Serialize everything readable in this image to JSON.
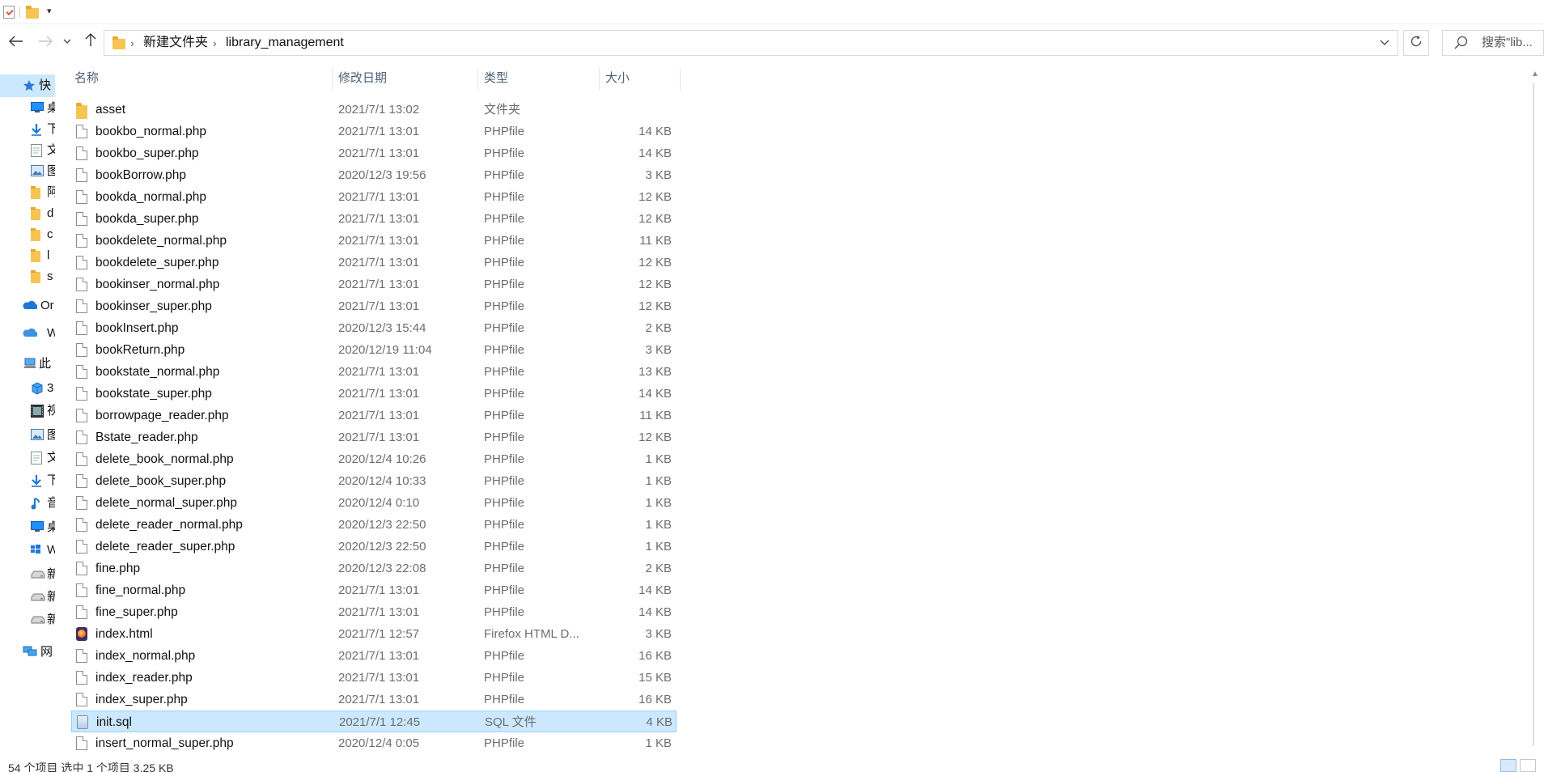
{
  "window": {
    "quick_access_dropdown": "▾"
  },
  "navigation": {
    "back_icon": "arrow-left-icon",
    "forward_icon": "arrow-right-icon",
    "recent_icon": "chevron-down-icon",
    "up_icon": "arrow-up-icon",
    "breadcrumb": [
      "新建文件夹",
      "library_management"
    ],
    "refresh_icon": "refresh-icon",
    "search_placeholder": "搜索\"lib..."
  },
  "nav_pane": [
    {
      "label": "快",
      "icon": "star-icon",
      "selected": true
    },
    {
      "label": "桌",
      "icon": "desktop-icon"
    },
    {
      "label": "下",
      "icon": "download-icon"
    },
    {
      "label": "文",
      "icon": "document-icon"
    },
    {
      "label": "图",
      "icon": "picture-icon"
    },
    {
      "label": "阿",
      "icon": "folder-icon"
    },
    {
      "label": "d",
      "icon": "folder-icon"
    },
    {
      "label": "c",
      "icon": "folder-icon"
    },
    {
      "label": "l",
      "icon": "folder-icon"
    },
    {
      "label": "s",
      "icon": "folder-icon"
    },
    {
      "label": "Or",
      "icon": "onedrive-icon"
    },
    {
      "label": "W",
      "icon": "cloud-icon"
    },
    {
      "label": "此",
      "icon": "computer-icon"
    },
    {
      "label": "3",
      "icon": "cube-icon"
    },
    {
      "label": "视",
      "icon": "video-icon"
    },
    {
      "label": "图",
      "icon": "picture-icon"
    },
    {
      "label": "文",
      "icon": "document-icon"
    },
    {
      "label": "下",
      "icon": "download-icon"
    },
    {
      "label": "音",
      "icon": "music-icon"
    },
    {
      "label": "桌",
      "icon": "desktop-icon"
    },
    {
      "label": "W",
      "icon": "windows-icon"
    },
    {
      "label": "新",
      "icon": "drive-icon"
    },
    {
      "label": "新",
      "icon": "drive-icon"
    },
    {
      "label": "新",
      "icon": "drive-icon"
    },
    {
      "label": "网",
      "icon": "network-icon"
    }
  ],
  "columns": {
    "name": "名称",
    "date": "修改日期",
    "type": "类型",
    "size": "大小",
    "sort_indicator": "^"
  },
  "files": [
    {
      "name": "asset",
      "date": "2021/7/1 13:02",
      "type": "文件夹",
      "size": "",
      "icon": "folder-icon"
    },
    {
      "name": "bookbo_normal.php",
      "date": "2021/7/1 13:01",
      "type": "PHPfile",
      "size": "14 KB",
      "icon": "file-icon"
    },
    {
      "name": "bookbo_super.php",
      "date": "2021/7/1 13:01",
      "type": "PHPfile",
      "size": "14 KB",
      "icon": "file-icon"
    },
    {
      "name": "bookBorrow.php",
      "date": "2020/12/3 19:56",
      "type": "PHPfile",
      "size": "3 KB",
      "icon": "file-icon"
    },
    {
      "name": "bookda_normal.php",
      "date": "2021/7/1 13:01",
      "type": "PHPfile",
      "size": "12 KB",
      "icon": "file-icon"
    },
    {
      "name": "bookda_super.php",
      "date": "2021/7/1 13:01",
      "type": "PHPfile",
      "size": "12 KB",
      "icon": "file-icon"
    },
    {
      "name": "bookdelete_normal.php",
      "date": "2021/7/1 13:01",
      "type": "PHPfile",
      "size": "11 KB",
      "icon": "file-icon"
    },
    {
      "name": "bookdelete_super.php",
      "date": "2021/7/1 13:01",
      "type": "PHPfile",
      "size": "12 KB",
      "icon": "file-icon"
    },
    {
      "name": "bookinser_normal.php",
      "date": "2021/7/1 13:01",
      "type": "PHPfile",
      "size": "12 KB",
      "icon": "file-icon"
    },
    {
      "name": "bookinser_super.php",
      "date": "2021/7/1 13:01",
      "type": "PHPfile",
      "size": "12 KB",
      "icon": "file-icon"
    },
    {
      "name": "bookInsert.php",
      "date": "2020/12/3 15:44",
      "type": "PHPfile",
      "size": "2 KB",
      "icon": "file-icon"
    },
    {
      "name": "bookReturn.php",
      "date": "2020/12/19 11:04",
      "type": "PHPfile",
      "size": "3 KB",
      "icon": "file-icon"
    },
    {
      "name": "bookstate_normal.php",
      "date": "2021/7/1 13:01",
      "type": "PHPfile",
      "size": "13 KB",
      "icon": "file-icon"
    },
    {
      "name": "bookstate_super.php",
      "date": "2021/7/1 13:01",
      "type": "PHPfile",
      "size": "14 KB",
      "icon": "file-icon"
    },
    {
      "name": "borrowpage_reader.php",
      "date": "2021/7/1 13:01",
      "type": "PHPfile",
      "size": "11 KB",
      "icon": "file-icon"
    },
    {
      "name": "Bstate_reader.php",
      "date": "2021/7/1 13:01",
      "type": "PHPfile",
      "size": "12 KB",
      "icon": "file-icon"
    },
    {
      "name": "delete_book_normal.php",
      "date": "2020/12/4 10:26",
      "type": "PHPfile",
      "size": "1 KB",
      "icon": "file-icon"
    },
    {
      "name": "delete_book_super.php",
      "date": "2020/12/4 10:33",
      "type": "PHPfile",
      "size": "1 KB",
      "icon": "file-icon"
    },
    {
      "name": "delete_normal_super.php",
      "date": "2020/12/4 0:10",
      "type": "PHPfile",
      "size": "1 KB",
      "icon": "file-icon"
    },
    {
      "name": "delete_reader_normal.php",
      "date": "2020/12/3 22:50",
      "type": "PHPfile",
      "size": "1 KB",
      "icon": "file-icon"
    },
    {
      "name": "delete_reader_super.php",
      "date": "2020/12/3 22:50",
      "type": "PHPfile",
      "size": "1 KB",
      "icon": "file-icon"
    },
    {
      "name": "fine.php",
      "date": "2020/12/3 22:08",
      "type": "PHPfile",
      "size": "2 KB",
      "icon": "file-icon"
    },
    {
      "name": "fine_normal.php",
      "date": "2021/7/1 13:01",
      "type": "PHPfile",
      "size": "14 KB",
      "icon": "file-icon"
    },
    {
      "name": "fine_super.php",
      "date": "2021/7/1 13:01",
      "type": "PHPfile",
      "size": "14 KB",
      "icon": "file-icon"
    },
    {
      "name": "index.html",
      "date": "2021/7/1 12:57",
      "type": "Firefox HTML D...",
      "size": "3 KB",
      "icon": "firefox-icon"
    },
    {
      "name": "index_normal.php",
      "date": "2021/7/1 13:01",
      "type": "PHPfile",
      "size": "16 KB",
      "icon": "file-icon"
    },
    {
      "name": "index_reader.php",
      "date": "2021/7/1 13:01",
      "type": "PHPfile",
      "size": "15 KB",
      "icon": "file-icon"
    },
    {
      "name": "index_super.php",
      "date": "2021/7/1 13:01",
      "type": "PHPfile",
      "size": "16 KB",
      "icon": "file-icon"
    },
    {
      "name": "init.sql",
      "date": "2021/7/1 12:45",
      "type": "SQL 文件",
      "size": "4 KB",
      "icon": "sql-icon",
      "selected": true
    },
    {
      "name": "insert_normal_super.php",
      "date": "2020/12/4 0:05",
      "type": "PHPfile",
      "size": "1 KB",
      "icon": "file-icon"
    }
  ],
  "status": {
    "text": "54 个项目    选中 1 个项目  3.25 KB"
  },
  "colors": {
    "selection_bg": "#cce8ff",
    "selection_border": "#99d1ff",
    "header_text": "#4c607a",
    "folder": "#f5c452"
  }
}
